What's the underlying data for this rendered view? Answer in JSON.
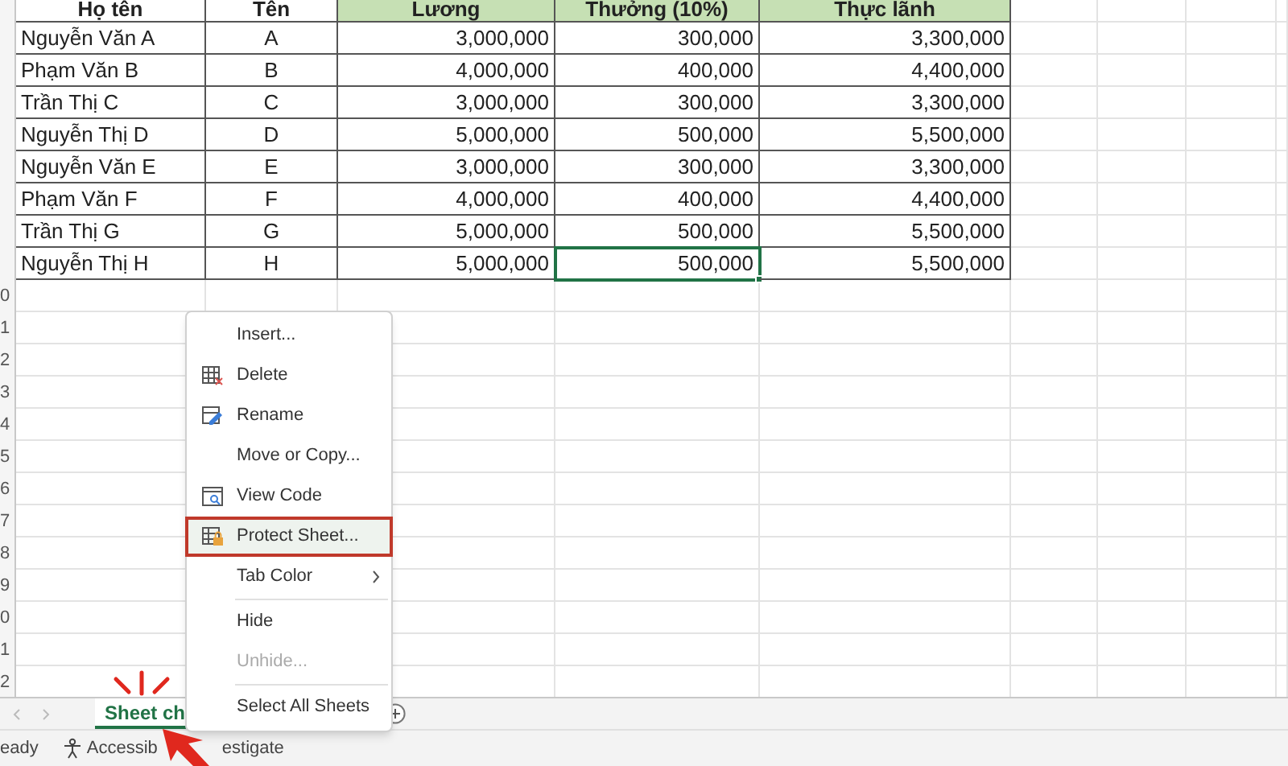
{
  "columns": [
    {
      "label": "Họ tên",
      "highlighted": false
    },
    {
      "label": "Tên",
      "highlighted": false
    },
    {
      "label": "Lương",
      "highlighted": true
    },
    {
      "label": "Thưởng (10%)",
      "highlighted": true
    },
    {
      "label": "Thực lãnh",
      "highlighted": true
    }
  ],
  "rows": [
    {
      "cells": [
        {
          "text": "Nguyễn Văn A",
          "selected": false
        },
        {
          "text": "A",
          "selected": false
        },
        {
          "text": "3,000,000",
          "selected": false
        },
        {
          "text": "300,000",
          "selected": false
        },
        {
          "text": "3,300,000",
          "selected": false
        }
      ]
    },
    {
      "cells": [
        {
          "text": "Phạm Văn B",
          "selected": false
        },
        {
          "text": "B",
          "selected": false
        },
        {
          "text": "4,000,000",
          "selected": false
        },
        {
          "text": "400,000",
          "selected": false
        },
        {
          "text": "4,400,000",
          "selected": false
        }
      ]
    },
    {
      "cells": [
        {
          "text": "Trần Thị C",
          "selected": false
        },
        {
          "text": "C",
          "selected": false
        },
        {
          "text": "3,000,000",
          "selected": false
        },
        {
          "text": "300,000",
          "selected": false
        },
        {
          "text": "3,300,000",
          "selected": false
        }
      ]
    },
    {
      "cells": [
        {
          "text": "Nguyễn Thị D",
          "selected": false
        },
        {
          "text": "D",
          "selected": false
        },
        {
          "text": "5,000,000",
          "selected": false
        },
        {
          "text": "500,000",
          "selected": false
        },
        {
          "text": "5,500,000",
          "selected": false
        }
      ]
    },
    {
      "cells": [
        {
          "text": "Nguyễn Văn E",
          "selected": false
        },
        {
          "text": "E",
          "selected": false
        },
        {
          "text": "3,000,000",
          "selected": false
        },
        {
          "text": "300,000",
          "selected": false
        },
        {
          "text": "3,300,000",
          "selected": false
        }
      ]
    },
    {
      "cells": [
        {
          "text": "Phạm Văn F",
          "selected": false
        },
        {
          "text": "F",
          "selected": false
        },
        {
          "text": "4,000,000",
          "selected": false
        },
        {
          "text": "400,000",
          "selected": false
        },
        {
          "text": "4,400,000",
          "selected": false
        }
      ]
    },
    {
      "cells": [
        {
          "text": "Trần Thị G",
          "selected": false
        },
        {
          "text": "G",
          "selected": false
        },
        {
          "text": "5,000,000",
          "selected": false
        },
        {
          "text": "500,000",
          "selected": false
        },
        {
          "text": "5,500,000",
          "selected": false
        }
      ]
    },
    {
      "cells": [
        {
          "text": "Nguyễn Thị H",
          "selected": false
        },
        {
          "text": "H",
          "selected": false
        },
        {
          "text": "5,000,000",
          "selected": false
        },
        {
          "text": "500,000",
          "selected": true
        },
        {
          "text": "5,500,000",
          "selected": false
        }
      ]
    }
  ],
  "row_numbers": [
    "0",
    "1",
    "2",
    "3",
    "4",
    "5",
    "6",
    "7",
    "8",
    "9",
    "0",
    "1",
    "2"
  ],
  "context_menu": {
    "items": [
      {
        "label": "Insert...",
        "disabled": false,
        "highlighted": false,
        "submenu": false,
        "separator_before": false
      },
      {
        "label": "Delete",
        "disabled": false,
        "highlighted": false,
        "submenu": false,
        "separator_before": false
      },
      {
        "label": "Rename",
        "disabled": false,
        "highlighted": false,
        "submenu": false,
        "separator_before": false
      },
      {
        "label": "Move or Copy...",
        "disabled": false,
        "highlighted": false,
        "submenu": false,
        "separator_before": false
      },
      {
        "label": "View Code",
        "disabled": false,
        "highlighted": false,
        "submenu": false,
        "separator_before": false
      },
      {
        "label": "Protect Sheet...",
        "disabled": false,
        "highlighted": true,
        "submenu": false,
        "separator_before": false
      },
      {
        "label": "Tab Color",
        "disabled": false,
        "highlighted": false,
        "submenu": true,
        "separator_before": false
      },
      {
        "label": "Hide",
        "disabled": false,
        "highlighted": false,
        "submenu": false,
        "separator_before": true
      },
      {
        "label": "Unhide...",
        "disabled": true,
        "highlighted": false,
        "submenu": false,
        "separator_before": false
      },
      {
        "label": "Select All Sheets",
        "disabled": false,
        "highlighted": false,
        "submenu": false,
        "separator_before": true
      }
    ]
  },
  "sheet_tabs": [
    {
      "label": "Sheet ch",
      "selected": true
    }
  ],
  "status_bar": {
    "mode": "eady",
    "accessibility": [
      "Accessib",
      "estigate"
    ]
  }
}
